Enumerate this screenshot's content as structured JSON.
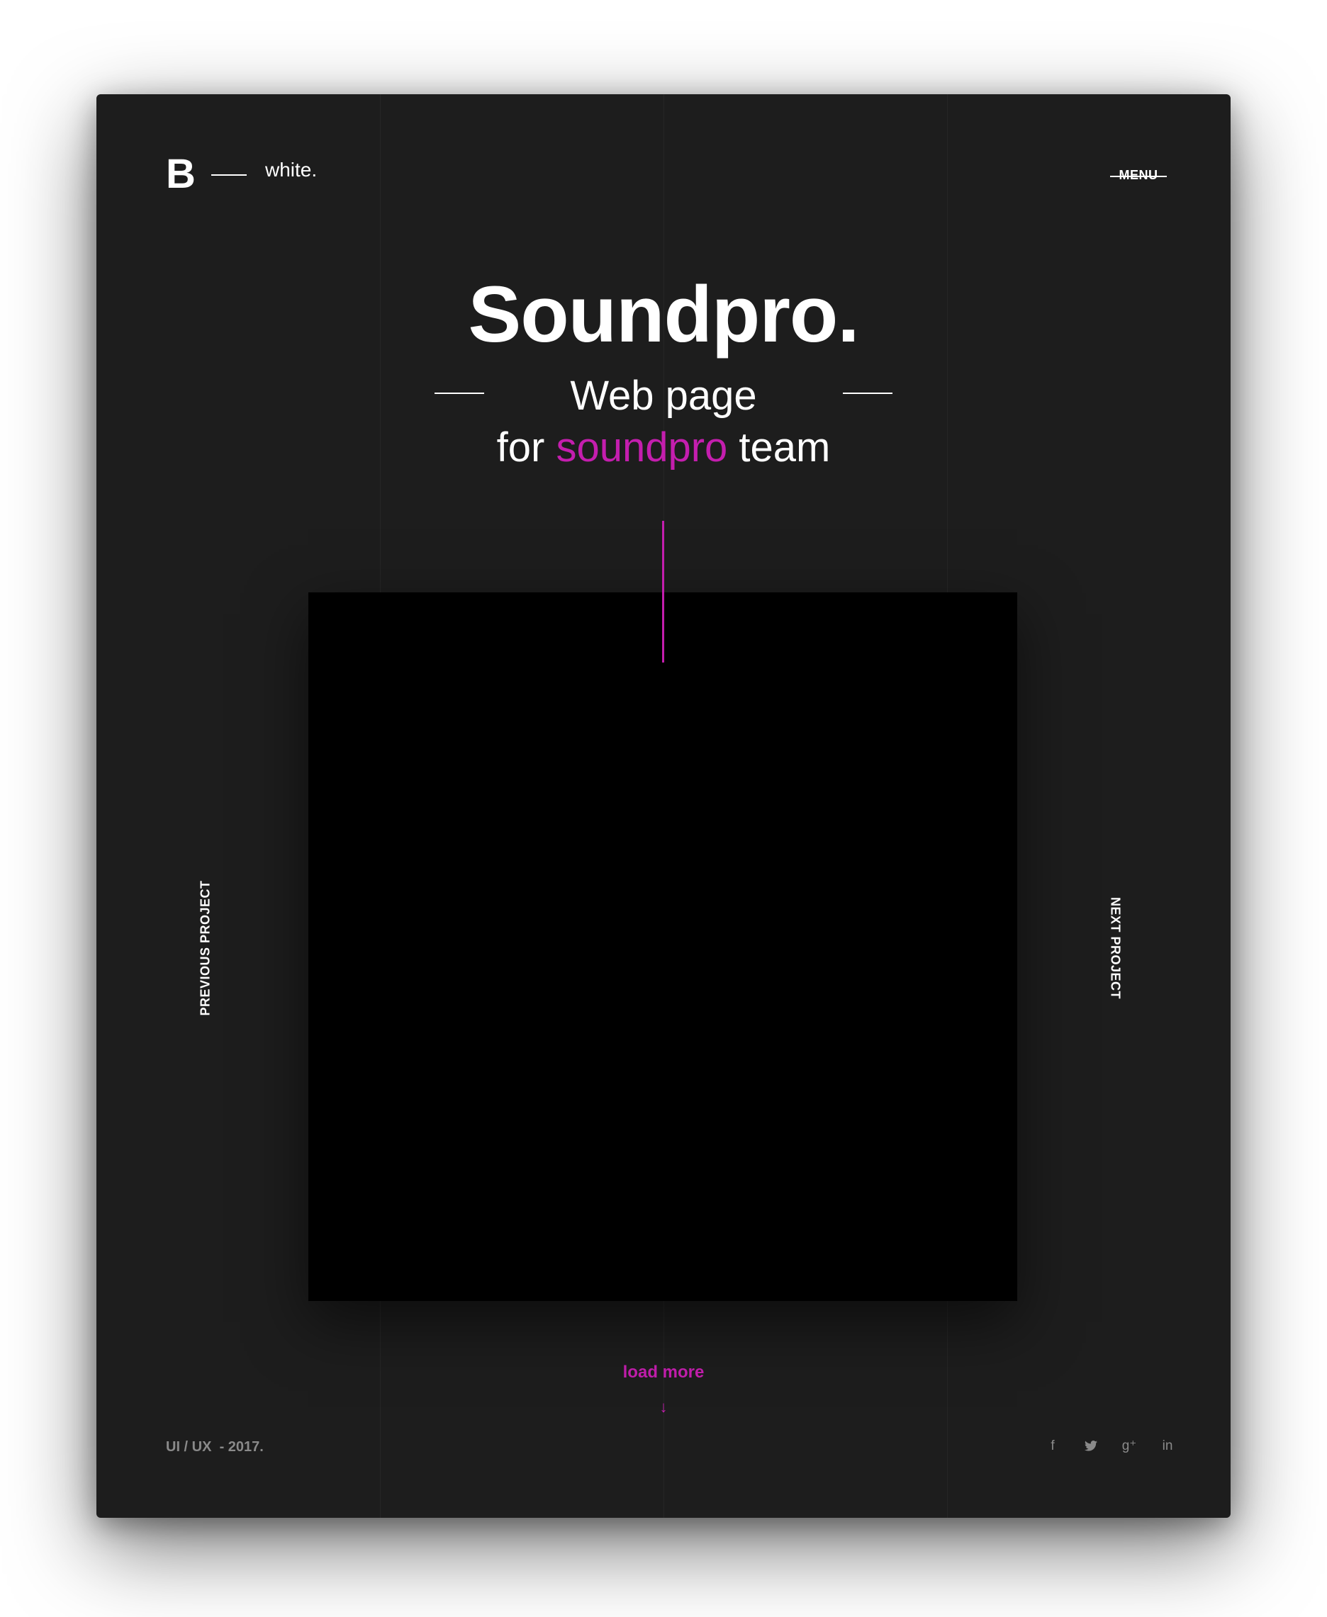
{
  "brand": {
    "mark": "B",
    "word": "white."
  },
  "header": {
    "menu_label": "MENU"
  },
  "hero": {
    "title": "Soundpro.",
    "subtitle_line1": "Web page",
    "subtitle_line2_pre": "for ",
    "subtitle_line2_accent": "soundpro",
    "subtitle_line2_post": " team"
  },
  "nav": {
    "previous": "PREVIOUS PROJECT",
    "next": "NEXT PROJECT"
  },
  "actions": {
    "load_more": "load more",
    "arrow": "↓"
  },
  "footer": {
    "meta": "UI / UX  - 2017.",
    "socials": [
      {
        "icon": "facebook-icon",
        "glyph": "f"
      },
      {
        "icon": "twitter-icon",
        "glyph": ""
      },
      {
        "icon": "google-plus-icon",
        "glyph": "g⁺"
      },
      {
        "icon": "linkedin-icon",
        "glyph": "in"
      }
    ]
  },
  "colors": {
    "background": "#1d1d1d",
    "accent": "#c41eae",
    "text": "#ffffff",
    "muted": "#8a8a8a"
  }
}
